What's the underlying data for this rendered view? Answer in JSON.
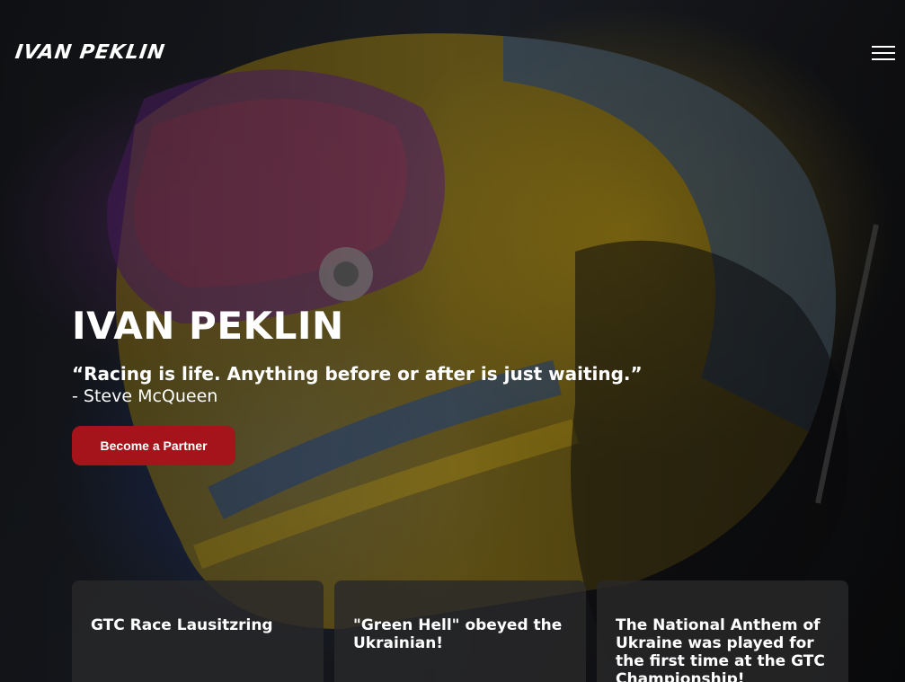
{
  "header": {
    "logo_text": "IVAN PEKLIN",
    "menu_icon": "hamburger-menu-icon"
  },
  "hero": {
    "title": "IVAN PEKLIN",
    "quote": "“Racing is life. Anything before or after is just waiting.”",
    "author": "- Steve McQueen",
    "cta_label": "Become a Partner",
    "cta_color": "#a5141a"
  },
  "news": {
    "cards": [
      {
        "title": "GTC Race Lausitzring"
      },
      {
        "title": "\"Green Hell\" obeyed the Ukrainian!"
      },
      {
        "title": "The National Anthem of Ukraine was played for the first time at the GTC Championship!"
      }
    ]
  },
  "colors": {
    "accent": "#a5141a",
    "card_bg": "#28282a",
    "text": "#ffffff"
  }
}
